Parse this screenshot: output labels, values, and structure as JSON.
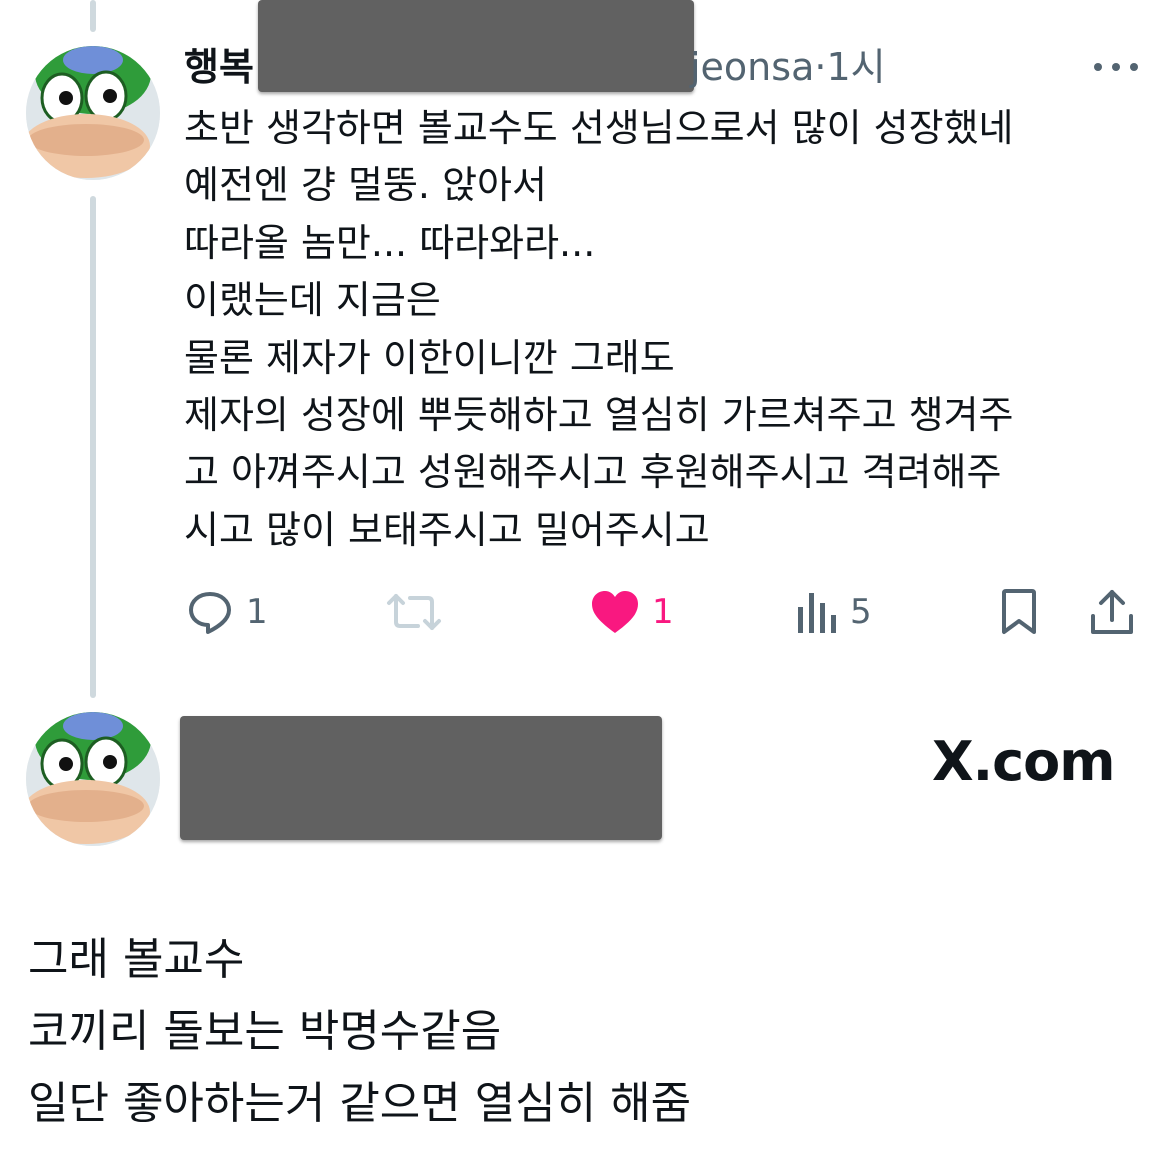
{
  "tweet": {
    "author_name_visible": "행복",
    "handle_visible": "jeonsa",
    "separator": "·",
    "time": "1시",
    "lines": [
      "초반 생각하면 볼교수도 선생님으로서 많이 성장했네",
      "예전엔 걍 멀뚱. 앉아서",
      "따라올 놈만... 따라와라...",
      "이랬는데 지금은",
      "물론 제자가 이한이니깐 그래도",
      "제자의 성장에 뿌듯해하고 열심히 가르쳐주고 챙겨주",
      "고 아껴주시고 성원해주시고 후원해주시고 격려해주",
      "시고 많이 보태주시고 밀어주시고"
    ],
    "actions": {
      "replies": "1",
      "reposts": "",
      "likes": "1",
      "views": "5"
    },
    "icons": [
      "reply-icon",
      "repost-icon",
      "heart-icon",
      "views-icon",
      "bookmark-icon",
      "share-icon",
      "more-icon"
    ],
    "like_color": "#f91880"
  },
  "second_author": {
    "source_label": "X.com"
  },
  "caption": {
    "lines": [
      "그래 볼교수",
      "코끼리 돌보는 박명수같음",
      "일단 좋아하는거 같으면 열심히 해줌"
    ]
  },
  "colors": {
    "text": "#0f1419",
    "muted": "#536471",
    "thread_line": "#cfd9de",
    "redaction": "#616161"
  }
}
